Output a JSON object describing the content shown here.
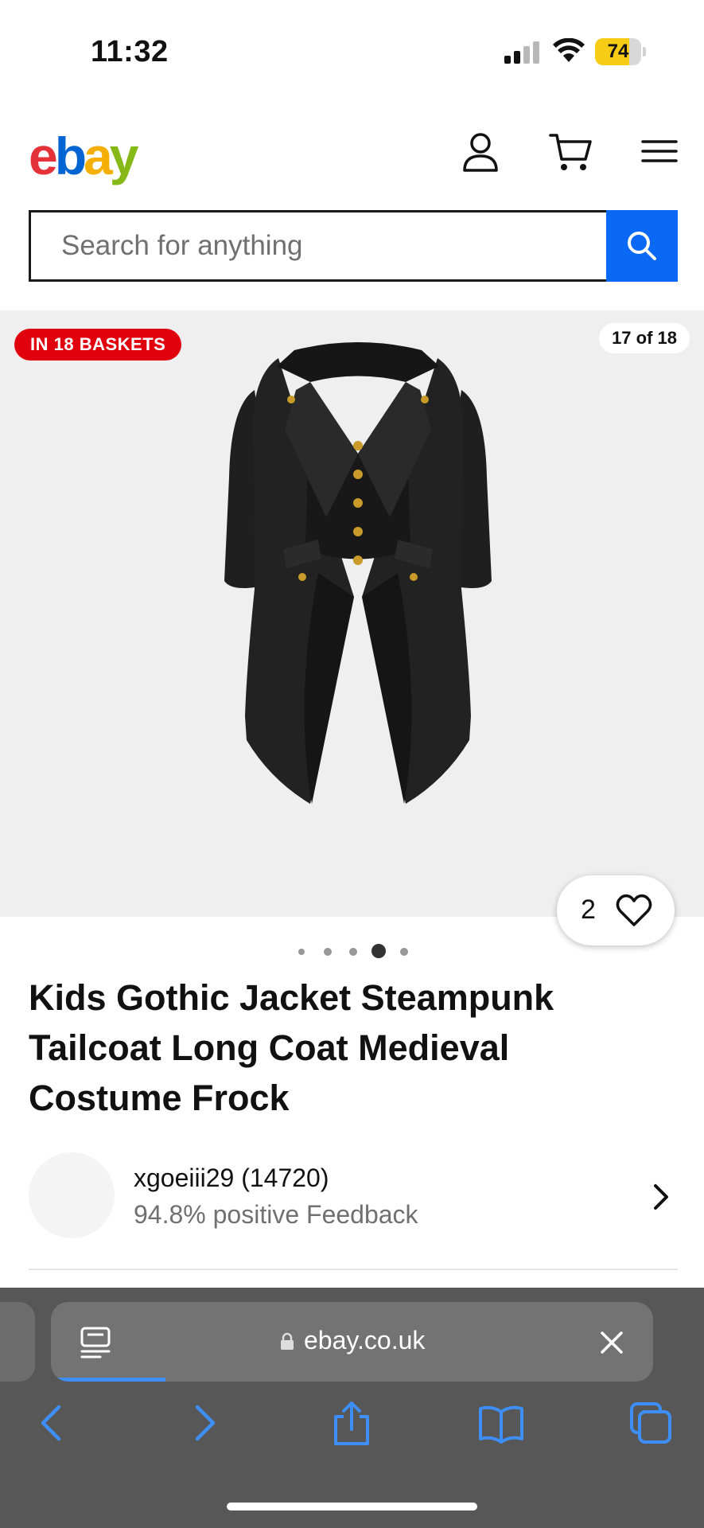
{
  "status_bar": {
    "time": "11:32",
    "battery": "74",
    "battery_level": 0.74,
    "battery_color": "#f7cc15"
  },
  "header": {
    "logo": {
      "e": "e",
      "b": "b",
      "a": "a",
      "y": "y"
    },
    "icons": [
      "account-icon",
      "cart-icon",
      "menu-icon"
    ],
    "search_placeholder": "Search for anything",
    "search_button_color": "#0968f6"
  },
  "gallery": {
    "badge": "IN 18 BASKETS",
    "counter": "17 of 18",
    "watch_count": "2",
    "dots_total": 5,
    "dots_active_index": 3
  },
  "listing": {
    "title": "Kids Gothic Jacket Steampunk Tailcoat Long Coat Medieval Costume Frock"
  },
  "seller": {
    "name": "xgoeiii29 (14720)",
    "feedback": "94.8% positive Feedback"
  },
  "browser": {
    "url": "ebay.co.uk",
    "load_progress": 0.19,
    "nav_icons": [
      "back-icon",
      "forward-icon",
      "share-icon",
      "bookmarks-icon",
      "tabs-icon"
    ],
    "accent_color": "#3e8ef7"
  }
}
